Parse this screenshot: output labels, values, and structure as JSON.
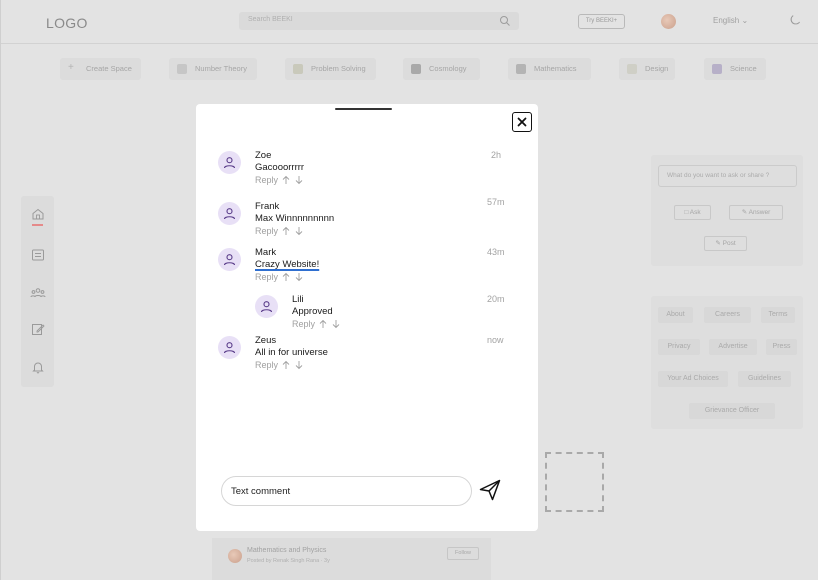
{
  "header": {
    "logo": "LOGO",
    "search_placeholder": "Search BEEKI",
    "try_button": "Try BEEKI+",
    "language": "English ⌄"
  },
  "topics": [
    {
      "label": "Create Space",
      "icon": "plus-icon"
    },
    {
      "label": "Number Theory",
      "icon": "topic-icon"
    },
    {
      "label": "Problem Solving",
      "icon": "topic-icon"
    },
    {
      "label": "Cosmology",
      "icon": "topic-icon"
    },
    {
      "label": "Mathematics",
      "icon": "topic-icon"
    },
    {
      "label": "Design",
      "icon": "topic-icon"
    },
    {
      "label": "Science",
      "icon": "topic-icon"
    }
  ],
  "sidebar": {
    "items": [
      {
        "name": "home-icon"
      },
      {
        "name": "list-icon"
      },
      {
        "name": "people-icon"
      },
      {
        "name": "edit-icon"
      },
      {
        "name": "bell-icon"
      }
    ]
  },
  "ask_panel": {
    "placeholder": "What do you want to ask or share ?",
    "ask": "Ask",
    "answer": "Answer",
    "post": "Post"
  },
  "info_links": [
    "About",
    "Careers",
    "Terms",
    "Privacy",
    "Advertise",
    "Press",
    "Your Ad Choices",
    "Guidelines",
    "Grievance Officer"
  ],
  "feed": {
    "title": "Mathematics and Physics",
    "subtitle": "Posted by Renak Singh Rana · 3y",
    "follow": "Follow"
  },
  "modal": {
    "comments": [
      {
        "name": "Zoe",
        "text": "Gacooorrrrr",
        "time": "2h",
        "reply": "Reply"
      },
      {
        "name": "Frank",
        "text": "Max Winnnnnnnnn",
        "time": "57m",
        "reply": "Reply"
      },
      {
        "name": "Mark",
        "text": "Crazy Website!",
        "time": "43m",
        "reply": "Reply"
      },
      {
        "name": "Lili",
        "text": "Approved",
        "time": "20m",
        "reply": "Reply"
      },
      {
        "name": "Zeus",
        "text": "All in for universe",
        "time": "now",
        "reply": "Reply"
      }
    ],
    "input_value": "Text comment"
  }
}
